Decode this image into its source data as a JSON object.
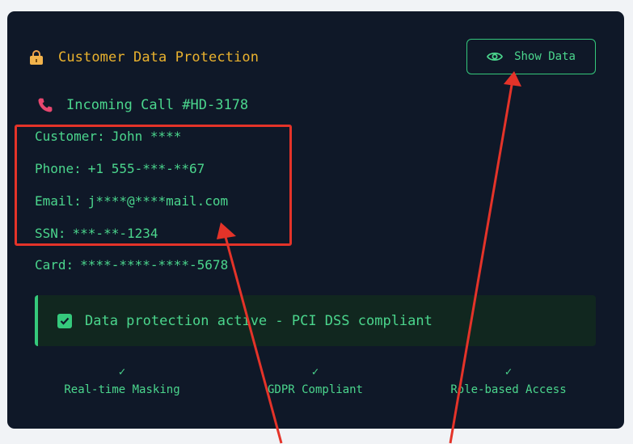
{
  "header": {
    "title": "Customer Data Protection",
    "icon": "lock-icon",
    "show_button_label": "Show Data",
    "show_button_icon": "eye-icon"
  },
  "call": {
    "icon": "phone-icon",
    "text": "Incoming Call #HD-3178"
  },
  "fields": [
    {
      "label": "Customer:",
      "value": "John ****"
    },
    {
      "label": "Phone:",
      "value": "+1 555-***-**67"
    },
    {
      "label": "Email:",
      "value": "j****@****mail.com"
    },
    {
      "label": "SSN:",
      "value": "***-**-1234"
    },
    {
      "label": "Card:",
      "value": "****-****-****-5678"
    }
  ],
  "status": {
    "icon": "checkbox-checked-icon",
    "text": "Data protection active - PCI DSS compliant"
  },
  "features": [
    {
      "tick": "✓",
      "label": "Real-time Masking"
    },
    {
      "tick": "✓",
      "label": "GDPR Compliant"
    },
    {
      "tick": "✓",
      "label": "Role-based Access"
    }
  ],
  "colors": {
    "card_background": "#0f1828",
    "accent_green": "#4bd68d",
    "title_yellow": "#eab22e",
    "annotation_red": "#e43329"
  }
}
